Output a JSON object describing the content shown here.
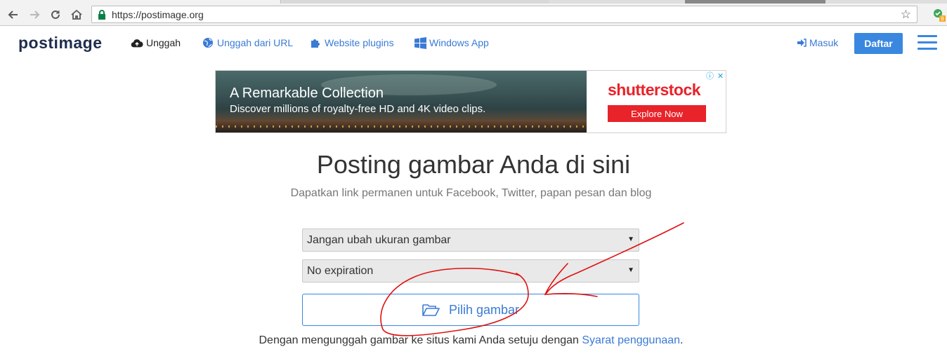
{
  "browser": {
    "url": "https://postimage.org",
    "extension_badge": "8"
  },
  "header": {
    "logo": "postimage",
    "nav": [
      {
        "label": "Unggah",
        "icon": "cloud-upload-icon"
      },
      {
        "label": "Unggah dari URL",
        "icon": "globe-icon"
      },
      {
        "label": "Website plugins",
        "icon": "puzzle-icon"
      },
      {
        "label": "Windows App",
        "icon": "windows-icon"
      }
    ],
    "login_label": "Masuk",
    "register_label": "Daftar"
  },
  "ad": {
    "headline": "A Remarkable Collection",
    "subline": "Discover millions of royalty-free HD and 4K video clips.",
    "brand": "shutterstock",
    "cta": "Explore Now"
  },
  "main": {
    "title": "Posting gambar Anda di sini",
    "subtitle": "Dapatkan link permanen untuk Facebook, Twitter, papan pesan dan blog",
    "resize_select": "Jangan ubah ukuran gambar",
    "expiration_select": "No expiration",
    "pick_button": "Pilih gambar",
    "terms_prefix": "Dengan mengunggah gambar ke situs kami Anda setuju dengan ",
    "terms_link": "Syarat penggunaan",
    "terms_suffix": "."
  },
  "colors": {
    "accent": "#3a87e0",
    "link": "#3a7bd5",
    "shutterstock_red": "#e8232a",
    "annotation": "#e01010"
  }
}
